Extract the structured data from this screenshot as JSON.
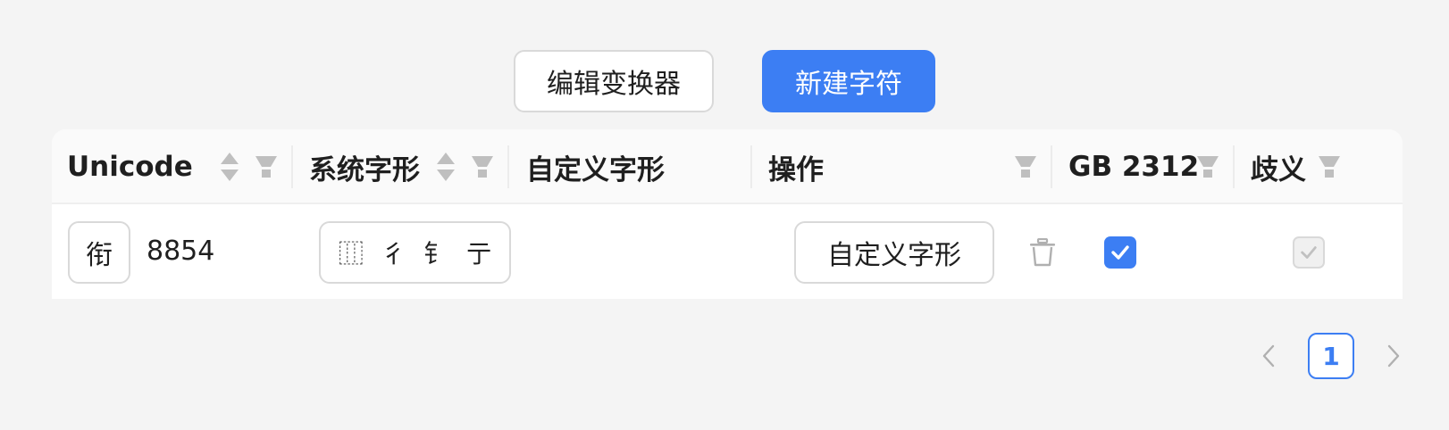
{
  "toolbar": {
    "edit_transformer_label": "编辑变换器",
    "new_character_label": "新建字符"
  },
  "table": {
    "columns": {
      "unicode": "Unicode",
      "system_glyph": "系统字形",
      "custom_glyph": "自定义字形",
      "actions": "操作",
      "gb2312": "GB 2312",
      "ambiguous": "歧义"
    },
    "rows": [
      {
        "character": "衔",
        "code": "8854",
        "glyph_parts": [
          "⿲",
          "彳",
          "钅",
          "亍"
        ],
        "action_label": "自定义字形",
        "gb2312": true,
        "ambiguous": true
      }
    ]
  },
  "pagination": {
    "current_page": "1"
  },
  "colors": {
    "primary": "#3c7ef3",
    "border": "#d9d9d9",
    "icon_gray": "#b0b0b0"
  },
  "icons": [
    "sort-icon",
    "filter-icon",
    "trash-icon",
    "check-icon",
    "chevron-left-icon",
    "chevron-right-icon"
  ]
}
